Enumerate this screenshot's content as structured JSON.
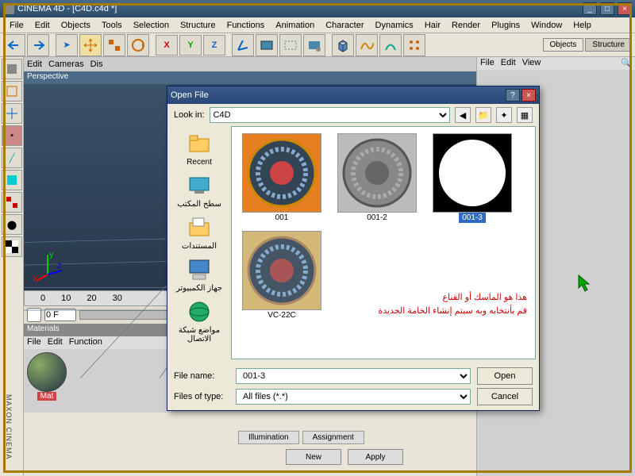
{
  "app": {
    "title": "CINEMA 4D - [C4D.c4d *]"
  },
  "menus": [
    "File",
    "Edit",
    "Objects",
    "Tools",
    "Selection",
    "Structure",
    "Functions",
    "Animation",
    "Character",
    "Dynamics",
    "Hair",
    "Render",
    "Plugins",
    "Window",
    "Help"
  ],
  "axes": [
    "X",
    "Y",
    "Z"
  ],
  "right_tabs": [
    "Objects",
    "Structure"
  ],
  "right_menus": [
    "File",
    "Edit",
    "View"
  ],
  "vp_menus": [
    "Edit",
    "Cameras",
    "Dis"
  ],
  "viewport_label": "Perspective",
  "ruler": [
    "0",
    "10",
    "20",
    "30"
  ],
  "slider": {
    "val": "0 F",
    "goto": "0"
  },
  "materials": {
    "title": "Materials",
    "menus": [
      "File",
      "Edit",
      "Function"
    ],
    "mat_label": "Mat"
  },
  "dialog": {
    "title": "Open File",
    "lookin_label": "Look in:",
    "folder": "C4D",
    "places": [
      {
        "label": "Recent",
        "icon": "folder"
      },
      {
        "label": "سطح المكتب",
        "icon": "desktop"
      },
      {
        "label": "المستندات",
        "icon": "docs"
      },
      {
        "label": "جهاز الكمبيوتر",
        "icon": "computer"
      },
      {
        "label": "مواضع شبكة الاتصال",
        "icon": "network"
      }
    ],
    "files": [
      {
        "name": "001",
        "kind": "ornate-orange"
      },
      {
        "name": "001-2",
        "kind": "ornate-grey"
      },
      {
        "name": "001-3",
        "kind": "mask",
        "selected": true
      },
      {
        "name": "VC-22C",
        "kind": "ornate-tan"
      }
    ],
    "filename_label": "File name:",
    "filename_value": "001-3",
    "filetype_label": "Files of type:",
    "filetype_value": "All files (*.*)",
    "open_btn": "Open",
    "cancel_btn": "Cancel"
  },
  "annotation": {
    "line1": "هذا هو الماسك أو القناع",
    "line2": "قم بأنتخابه وبه سيتم إنشاء الخامة الجديدة"
  },
  "bottom_tabs": [
    "Illumination",
    "Assignment"
  ],
  "apply": {
    "new": "New",
    "Apply": "Apply"
  },
  "maxon": "MAXON CINEMA"
}
